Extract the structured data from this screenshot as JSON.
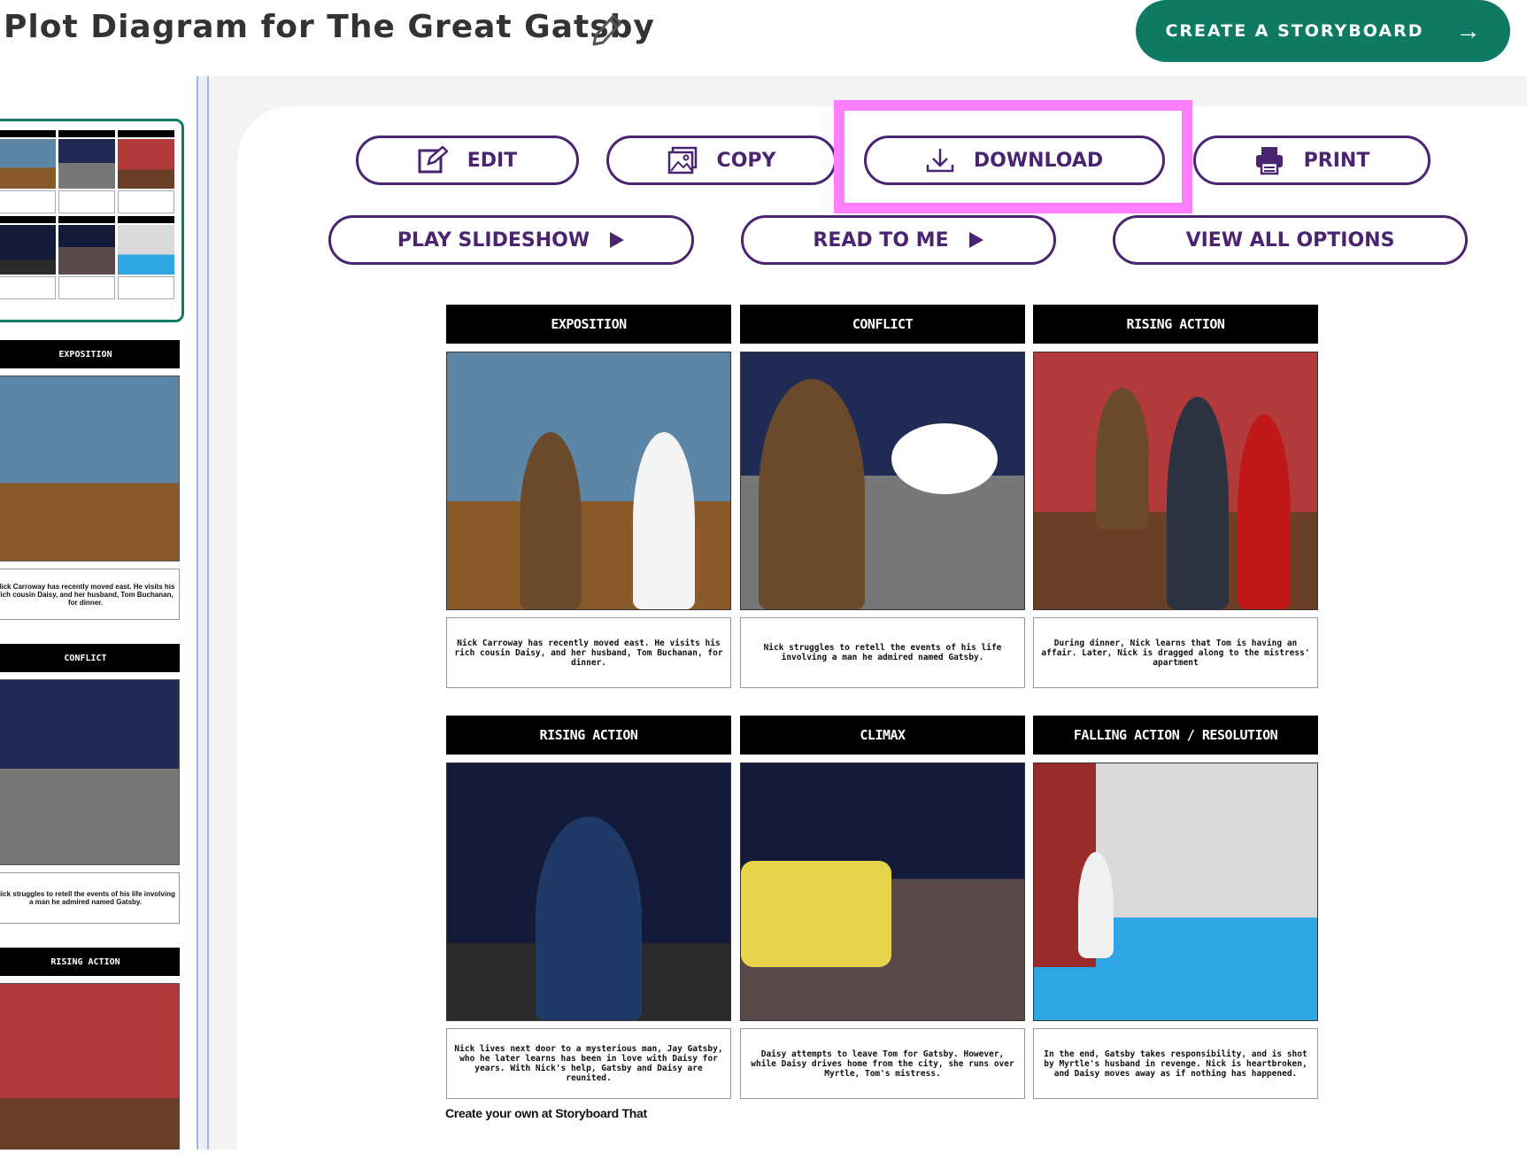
{
  "header": {
    "title": "Plot Diagram for The Great Gatsby",
    "cta_label": "CREATE A STORYBOARD",
    "cta_arrow": "→"
  },
  "toolbar": {
    "edit": "EDIT",
    "copy": "COPY",
    "download": "DOWNLOAD",
    "print": "PRINT",
    "slideshow": "PLAY SLIDESHOW",
    "read": "READ TO ME",
    "options": "VIEW ALL OPTIONS"
  },
  "sidebar": {
    "frames": [
      {
        "title": "EXPOSITION",
        "text": "Nick Carroway has recently moved east. He visits his rich cousin Daisy, and her husband, Tom Buchanan, for dinner."
      },
      {
        "title": "CONFLICT",
        "text": "Nick struggles to retell the events of his life involving a man he admired named Gatsby."
      },
      {
        "title": "RISING ACTION",
        "text": ""
      }
    ]
  },
  "storyboard": {
    "cells": [
      {
        "title": "EXPOSITION",
        "text": "Nick Carroway has recently moved east. He visits his rich cousin Daisy, and her husband, Tom Buchanan, for dinner."
      },
      {
        "title": "CONFLICT",
        "text": "Nick struggles to retell the events of his life involving a man he admired named Gatsby."
      },
      {
        "title": "RISING ACTION",
        "text": "During dinner, Nick learns that Tom is having an affair. Later, Nick is dragged along to the mistress' apartment"
      },
      {
        "title": "RISING ACTION",
        "text": "Nick lives next door to a mysterious man, Jay Gatsby, who he later learns has been in love with Daisy for years. With Nick's help, Gatsby and Daisy are reunited."
      },
      {
        "title": "CLIMAX",
        "text": "Daisy attempts to leave Tom for Gatsby. However, while Daisy drives home from the city, she runs over Myrtle, Tom's mistress."
      },
      {
        "title": "FALLING ACTION / RESOLUTION",
        "text": "In the end, Gatsby takes responsibility, and is shot by Myrtle's husband in revenge. Nick is heartbroken, and Daisy moves away as if nothing has happened."
      }
    ],
    "credit": "Create your own at Storyboard That"
  },
  "colors": {
    "brand_green": "#0f7a64",
    "button_purple": "#4a2471",
    "highlight_pink": "#ff7eff"
  },
  "icons": [
    "pencil-icon",
    "arrow-right-icon",
    "edit-icon",
    "image-icon",
    "download-icon",
    "printer-icon",
    "play-icon"
  ]
}
